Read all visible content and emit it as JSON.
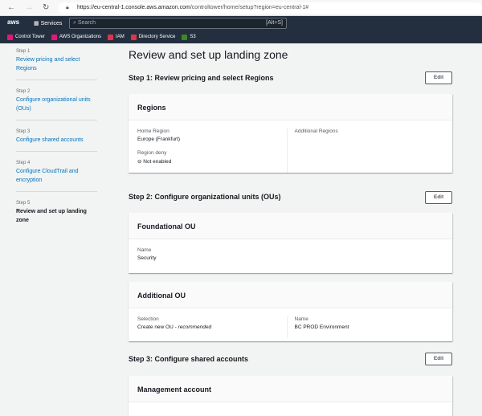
{
  "browser": {
    "url_host": "https://eu-central-1.console.aws.amazon.com",
    "url_path": "/controltower/home/setup?region=eu-central-1#"
  },
  "topnav": {
    "logo": "aws",
    "services": "Services",
    "search_placeholder": "Search",
    "search_shortcut": "[Alt+S]"
  },
  "favorites": [
    {
      "label": "Control Tower",
      "color": "#e7157b"
    },
    {
      "label": "AWS Organizations",
      "color": "#e7157b"
    },
    {
      "label": "IAM",
      "color": "#dd344c"
    },
    {
      "label": "Directory Service",
      "color": "#dd344c"
    },
    {
      "label": "S3",
      "color": "#3f8624"
    }
  ],
  "steps": [
    {
      "num": "Step 1",
      "label": "Review pricing and select Regions"
    },
    {
      "num": "Step 2",
      "label": "Configure organizational units (OUs)"
    },
    {
      "num": "Step 3",
      "label": "Configure shared accounts"
    },
    {
      "num": "Step 4",
      "label": "Configure CloudTrail and encryption"
    },
    {
      "num": "Step 5",
      "label": "Review and set up landing zone"
    }
  ],
  "main": {
    "title": "Review and set up landing zone",
    "edit": "Edit",
    "s1": {
      "heading": "Step 1: Review pricing and select Regions",
      "card": "Regions",
      "home_label": "Home Region",
      "home_value": "Europe (Frankfurt)",
      "deny_label": "Region deny",
      "deny_value": "Not enabled",
      "additional_label": "Additional Regions"
    },
    "s2": {
      "heading": "Step 2: Configure organizational units (OUs)",
      "foundational": "Foundational OU",
      "name_label": "Name",
      "name_value": "Security",
      "additional": "Additional OU",
      "selection_label": "Selection",
      "selection_value": "Create new OU - ",
      "selection_note": "recommended",
      "add_name_label": "Name",
      "add_name_value": "BC PROD Environment"
    },
    "s3": {
      "heading": "Step 3: Configure shared accounts",
      "card": "Management account"
    }
  }
}
